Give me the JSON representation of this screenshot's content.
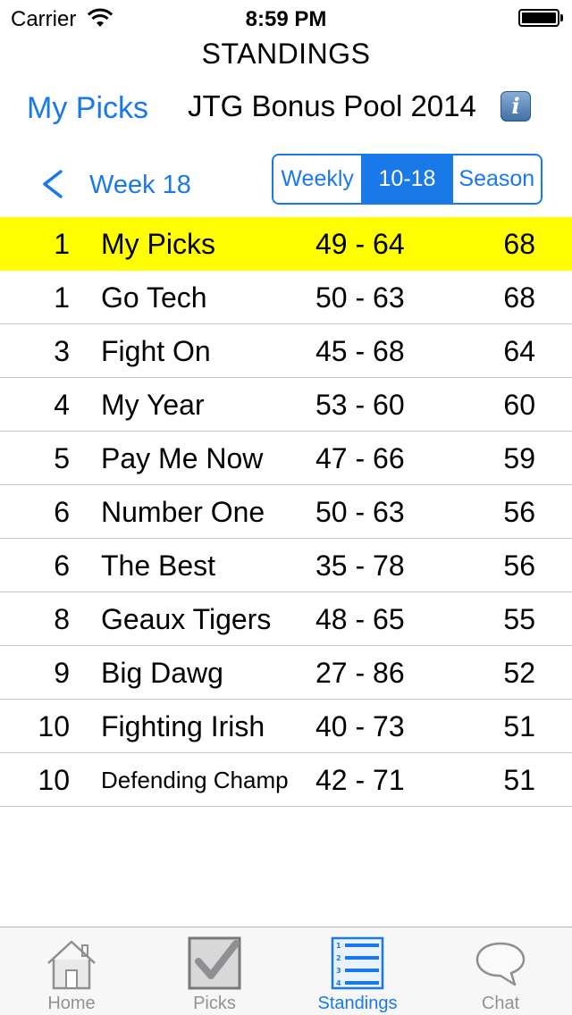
{
  "status_bar": {
    "carrier": "Carrier",
    "time": "8:59 PM"
  },
  "header": {
    "title": "STANDINGS",
    "my_picks_link": "My Picks",
    "pool_name": "JTG Bonus Pool 2014",
    "info_icon": "info-icon",
    "info_glyph": "i"
  },
  "week_nav": {
    "label": "Week 18",
    "back_icon": "chevron-left-icon"
  },
  "segments": [
    {
      "label": "Weekly",
      "selected": false
    },
    {
      "label": "10-18",
      "selected": true
    },
    {
      "label": "Season",
      "selected": false
    }
  ],
  "standings": [
    {
      "rank": "1",
      "name": "My Picks",
      "record": "49 - 64",
      "points": "68",
      "highlight": true
    },
    {
      "rank": "1",
      "name": "Go Tech",
      "record": "50 - 63",
      "points": "68"
    },
    {
      "rank": "3",
      "name": "Fight On",
      "record": "45 - 68",
      "points": "64"
    },
    {
      "rank": "4",
      "name": "My Year",
      "record": "53 - 60",
      "points": "60"
    },
    {
      "rank": "5",
      "name": "Pay Me Now",
      "record": "47 - 66",
      "points": "59"
    },
    {
      "rank": "6",
      "name": "Number One",
      "record": "50 - 63",
      "points": "56"
    },
    {
      "rank": "6",
      "name": "The Best",
      "record": "35 - 78",
      "points": "56"
    },
    {
      "rank": "8",
      "name": "Geaux Tigers",
      "record": "48 - 65",
      "points": "55"
    },
    {
      "rank": "9",
      "name": "Big Dawg",
      "record": "27 - 86",
      "points": "52"
    },
    {
      "rank": "10",
      "name": "Fighting Irish",
      "record": "40 - 73",
      "points": "51"
    },
    {
      "rank": "10",
      "name": "Defending Champ",
      "record": "42 - 71",
      "points": "51"
    }
  ],
  "tab_bar": [
    {
      "label": "Home",
      "icon": "home-icon",
      "active": false
    },
    {
      "label": "Picks",
      "icon": "checkmark-icon",
      "active": false
    },
    {
      "label": "Standings",
      "icon": "list-icon",
      "active": true
    },
    {
      "label": "Chat",
      "icon": "chat-bubble-icon",
      "active": false
    }
  ],
  "colors": {
    "accent": "#1a79e8",
    "highlight_row": "#ffff00",
    "tab_inactive": "#929292"
  }
}
